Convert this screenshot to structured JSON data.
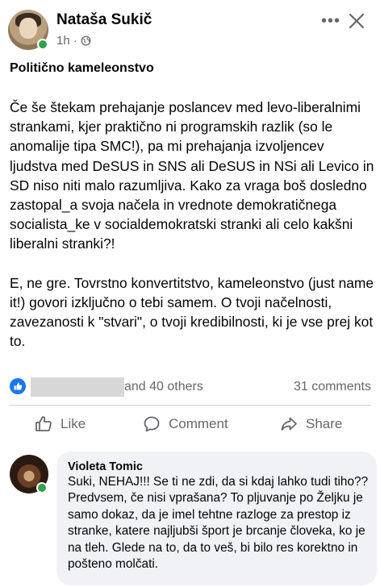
{
  "post": {
    "author": "Nataša Sukič",
    "time": "1h",
    "separator": "·",
    "title": "Politično kameleonstvo",
    "paragraphs": [
      "Če še štekam prehajanje poslancev med levo-liberalnimi strankami, kjer praktično ni programskih razlik (so le anomalije tipa SMC!), pa mi prehajanja izvoljencev ljudstva med DeSUS in SNS ali DeSUS in NSi ali Levico in SD niso niti malo razumljiva. Kako za vraga boš dosledno zastopal_a svoja načela in vrednote demokratičnega socialista_ke v socialdemokratski stranki ali celo kakšni liberalni stranki?!",
      "E, ne gre. Tovrstno konvertitstvo, kameleonstvo (just name it!) govori izključno o tebi samem. O tvoji načelnosti, zavezanosti k \"stvari\", o tvoji kredibilnosti, ki je vse prej kot to."
    ]
  },
  "reactions": {
    "others_text": "and 40 others",
    "comments_text": "31 comments"
  },
  "actions": {
    "like": "Like",
    "comment": "Comment",
    "share": "Share"
  },
  "comment": {
    "author": "Violeta Tomic",
    "text": "Suki, NEHAJ!!!  Se ti ne zdi, da si kdaj lahko tudi tiho?? Predvsem, če nisi vprašana? To pljuvanje po Željku je samo dokaz, da je imel tehtne razloge za prestop iz stranke, katere najljubši šport je brcanje človeka, ko je na tleh. Glede na to, da to veš, bi bilo res korektno in pošteno molčati."
  },
  "icons": {
    "more": "more-options-icon",
    "close": "close-icon",
    "privacy": "globe-icon",
    "like_badge": "thumbs-up-icon",
    "like": "thumbs-up-outline-icon",
    "comment": "speech-bubble-icon",
    "share": "share-arrow-icon"
  },
  "colors": {
    "accent": "#1877f2",
    "secondary_text": "#65676b",
    "online": "#31a24c",
    "comment_bubble": "#f0f2f5"
  }
}
